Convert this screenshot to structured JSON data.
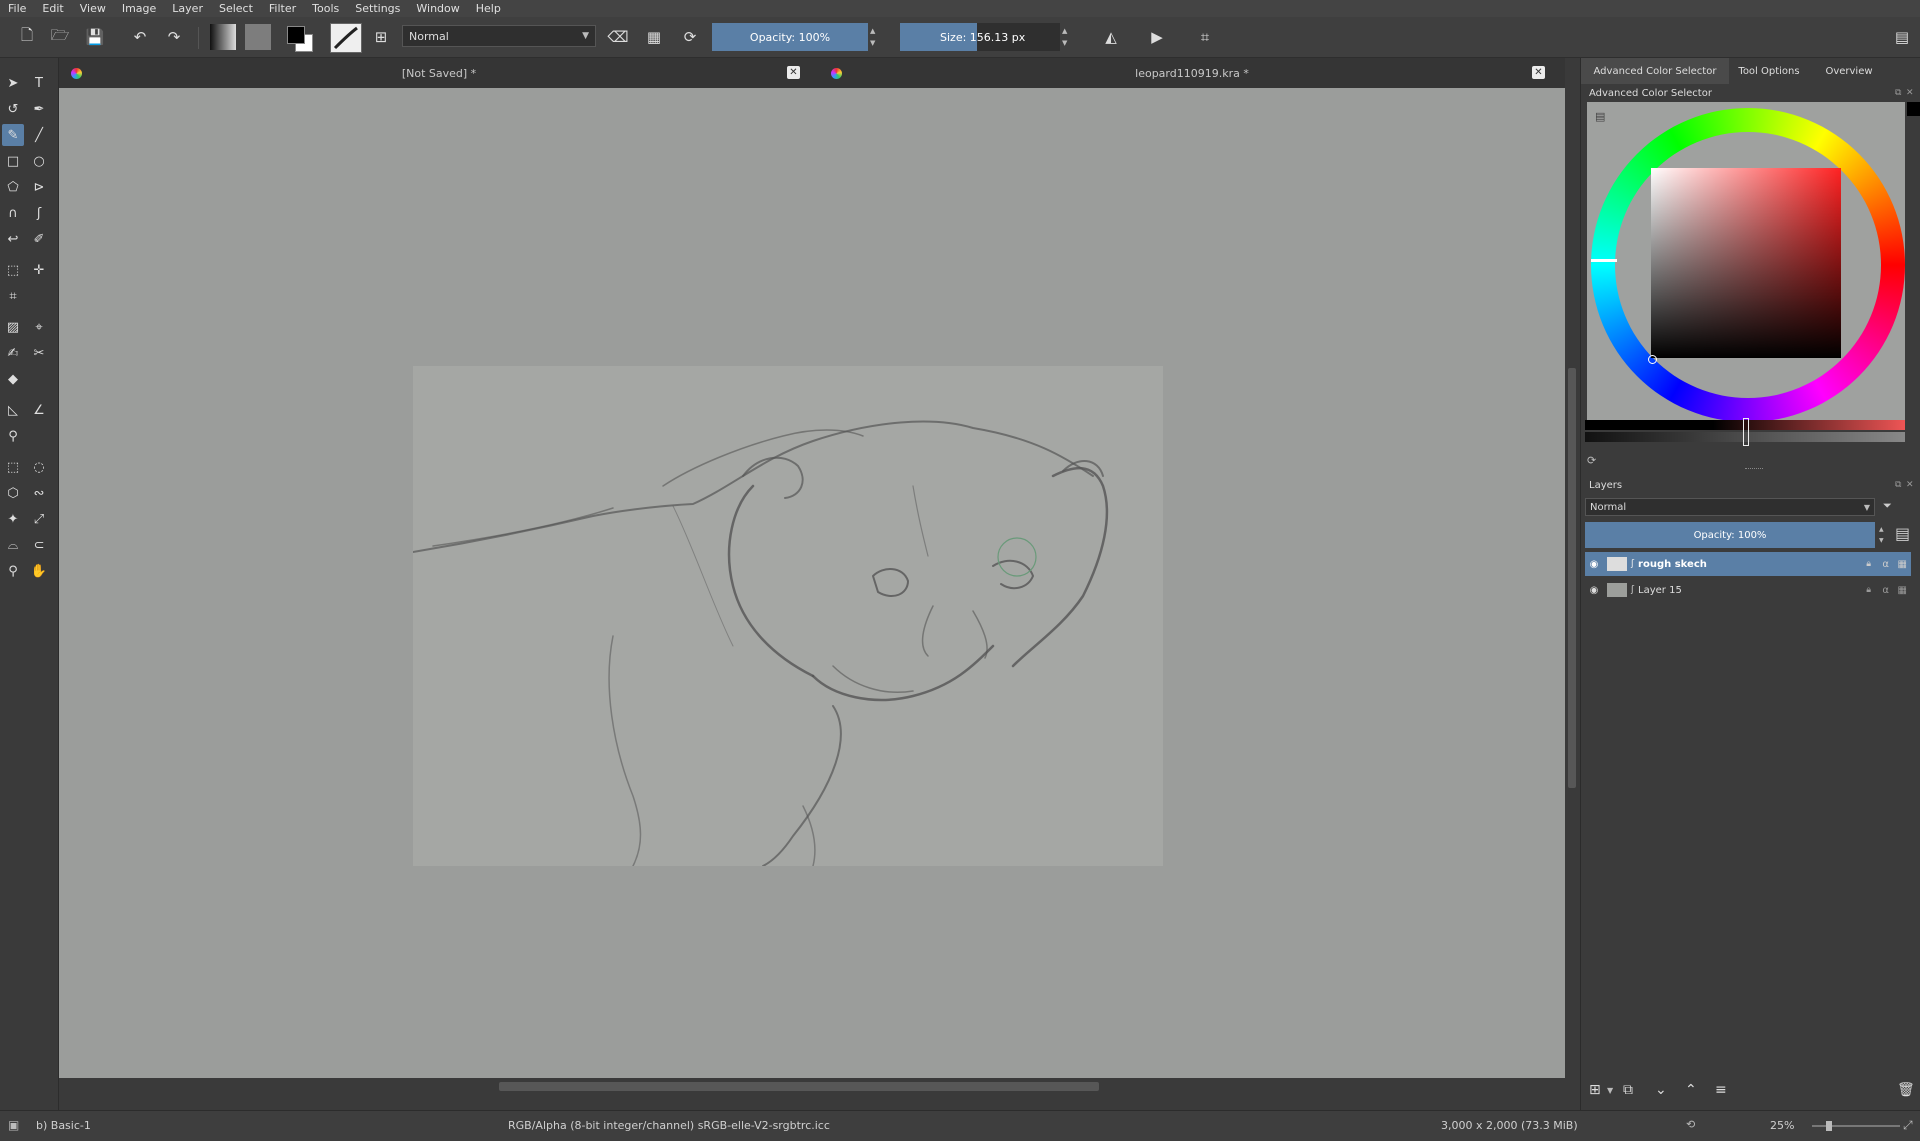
{
  "menu": [
    "File",
    "Edit",
    "View",
    "Image",
    "Layer",
    "Select",
    "Filter",
    "Tools",
    "Settings",
    "Window",
    "Help"
  ],
  "toolbar": {
    "blend_mode": "Normal",
    "opacity_label": "Opacity:  100%",
    "opacity_value": 100,
    "size_label": "Size:  156.13 px",
    "size_fraction": 0.48,
    "colors": {
      "foreground": "#000000",
      "background": "#ffffff",
      "accent": "#5a7fa6"
    }
  },
  "tabs": [
    {
      "title": "[Not Saved]  *"
    },
    {
      "title": "leopard110919.kra *"
    }
  ],
  "docker": {
    "tabs": [
      "Advanced Color Selector",
      "Tool Options",
      "Overview"
    ],
    "color_selector_title": "Advanced Color Selector",
    "layers_title": "Layers",
    "layers_blend": "Normal",
    "layers_opacity": "Opacity:  100%",
    "layers": [
      {
        "name": "rough skech",
        "selected": true
      },
      {
        "name": "Layer 15",
        "selected": false
      }
    ]
  },
  "status": {
    "brush": "b) Basic-1",
    "color_info": "RGB/Alpha (8-bit integer/channel)  sRGB-elle-V2-srgbtrc.icc",
    "dimensions": "3,000 x 2,000 (73.3 MiB)",
    "zoom": "25%"
  }
}
